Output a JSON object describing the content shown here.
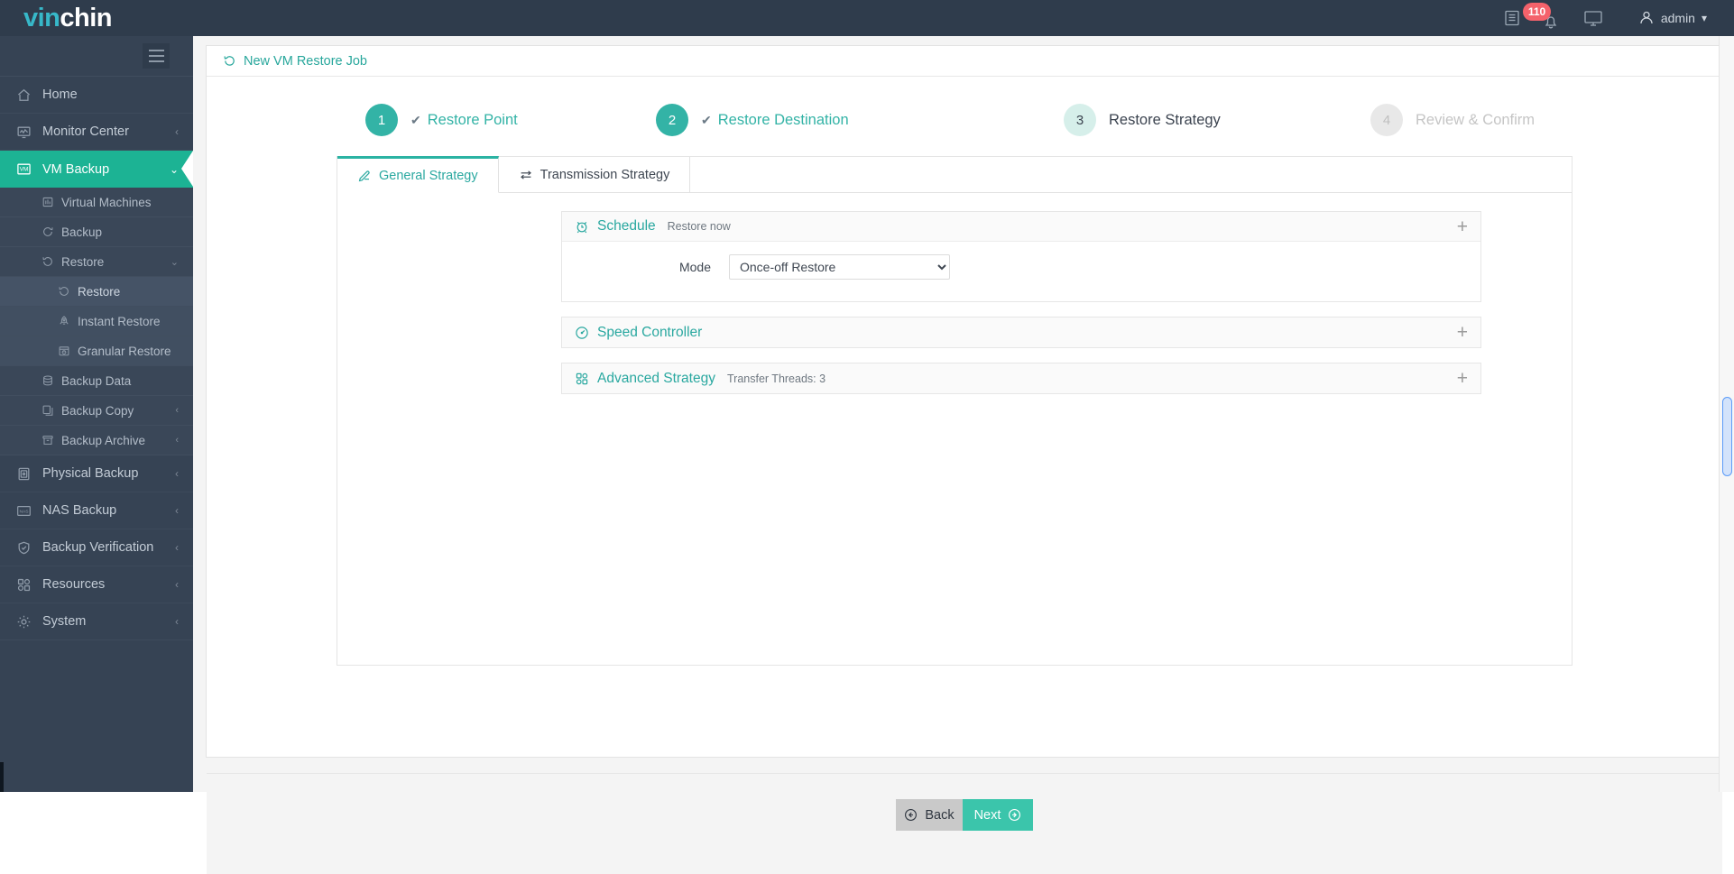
{
  "brand": {
    "part1": "vin",
    "part2": "chin"
  },
  "topbar": {
    "doc_icon": "document-icon",
    "bell_icon": "bell-icon",
    "notification_count": "110",
    "screen_icon": "monitor-icon",
    "user_icon": "user-icon",
    "username": "admin",
    "user_caret": "chevron-down-icon"
  },
  "sidebar": {
    "hamburger": "hamburger-icon",
    "items": [
      {
        "label": "Home",
        "icon": "home-icon",
        "caret": "",
        "level": 1,
        "state": "normal"
      },
      {
        "label": "Monitor Center",
        "icon": "monitor-chart-icon",
        "caret": "‹",
        "level": 1,
        "state": "normal"
      },
      {
        "label": "VM Backup",
        "icon": "vm-icon",
        "caret": "⌄",
        "level": 1,
        "state": "active"
      },
      {
        "label": "Virtual Machines",
        "icon": "grid-icon",
        "caret": "",
        "level": 2,
        "state": "normal"
      },
      {
        "label": "Backup",
        "icon": "refresh-icon",
        "caret": "",
        "level": 2,
        "state": "normal"
      },
      {
        "label": "Restore",
        "icon": "restore-icon",
        "caret": "⌄",
        "level": 2,
        "state": "expanded"
      },
      {
        "label": "Restore",
        "icon": "restore-icon",
        "caret": "",
        "level": 3,
        "state": "selected"
      },
      {
        "label": "Instant Restore",
        "icon": "rocket-icon",
        "caret": "",
        "level": 3,
        "state": "normal"
      },
      {
        "label": "Granular Restore",
        "icon": "calendar-icon",
        "caret": "",
        "level": 3,
        "state": "normal"
      },
      {
        "label": "Backup Data",
        "icon": "database-icon",
        "caret": "",
        "level": 2,
        "state": "normal"
      },
      {
        "label": "Backup Copy",
        "icon": "copy-icon",
        "caret": "‹",
        "level": 2,
        "state": "normal"
      },
      {
        "label": "Backup Archive",
        "icon": "archive-icon",
        "caret": "‹",
        "level": 2,
        "state": "normal"
      },
      {
        "label": "Physical Backup",
        "icon": "server-icon",
        "caret": "‹",
        "level": 1,
        "state": "normal"
      },
      {
        "label": "NAS Backup",
        "icon": "nas-icon",
        "caret": "‹",
        "level": 1,
        "state": "normal"
      },
      {
        "label": "Backup Verification",
        "icon": "shield-check-icon",
        "caret": "‹",
        "level": 1,
        "state": "normal"
      },
      {
        "label": "Resources",
        "icon": "blocks-icon",
        "caret": "‹",
        "level": 1,
        "state": "normal"
      },
      {
        "label": "System",
        "icon": "gear-icon",
        "caret": "‹",
        "level": 1,
        "state": "normal"
      }
    ]
  },
  "page": {
    "title": "New VM Restore Job",
    "title_icon": "restore-icon"
  },
  "steps": [
    {
      "number": "1",
      "label": "Restore Point",
      "state": "done",
      "check": "✔"
    },
    {
      "number": "2",
      "label": "Restore Destination",
      "state": "done",
      "check": "✔"
    },
    {
      "number": "3",
      "label": "Restore Strategy",
      "state": "current",
      "check": ""
    },
    {
      "number": "4",
      "label": "Review & Confirm",
      "state": "todo",
      "check": ""
    }
  ],
  "tabs": [
    {
      "label": "General Strategy",
      "icon": "pencil-icon",
      "active": true
    },
    {
      "label": "Transmission Strategy",
      "icon": "transfer-icon",
      "active": false
    }
  ],
  "panels": [
    {
      "title": "Schedule",
      "icon": "alarm-clock-icon",
      "summary": "Restore now",
      "expand_icon": "+",
      "expanded": true,
      "field_label": "Mode",
      "field_value": "Once-off Restore",
      "field_options": [
        "Once-off Restore"
      ]
    },
    {
      "title": "Speed Controller",
      "icon": "speedometer-icon",
      "summary": "",
      "expand_icon": "+",
      "expanded": false
    },
    {
      "title": "Advanced Strategy",
      "icon": "blocks-icon",
      "summary": "Transfer Threads: 3",
      "expand_icon": "+",
      "expanded": false
    }
  ],
  "footer": {
    "back_label": "Back",
    "back_icon": "arrow-left-circle-icon",
    "next_label": "Next",
    "next_icon": "arrow-right-circle-icon"
  },
  "colors": {
    "brand_teal": "#1cb394",
    "accent_teal": "#2aa8a0",
    "topbar_bg": "#2f3c4c",
    "sidebar_bg": "#364354",
    "badge_red": "#f4626b",
    "next_btn": "#3bc5ab",
    "back_btn": "#c9c9c9"
  }
}
